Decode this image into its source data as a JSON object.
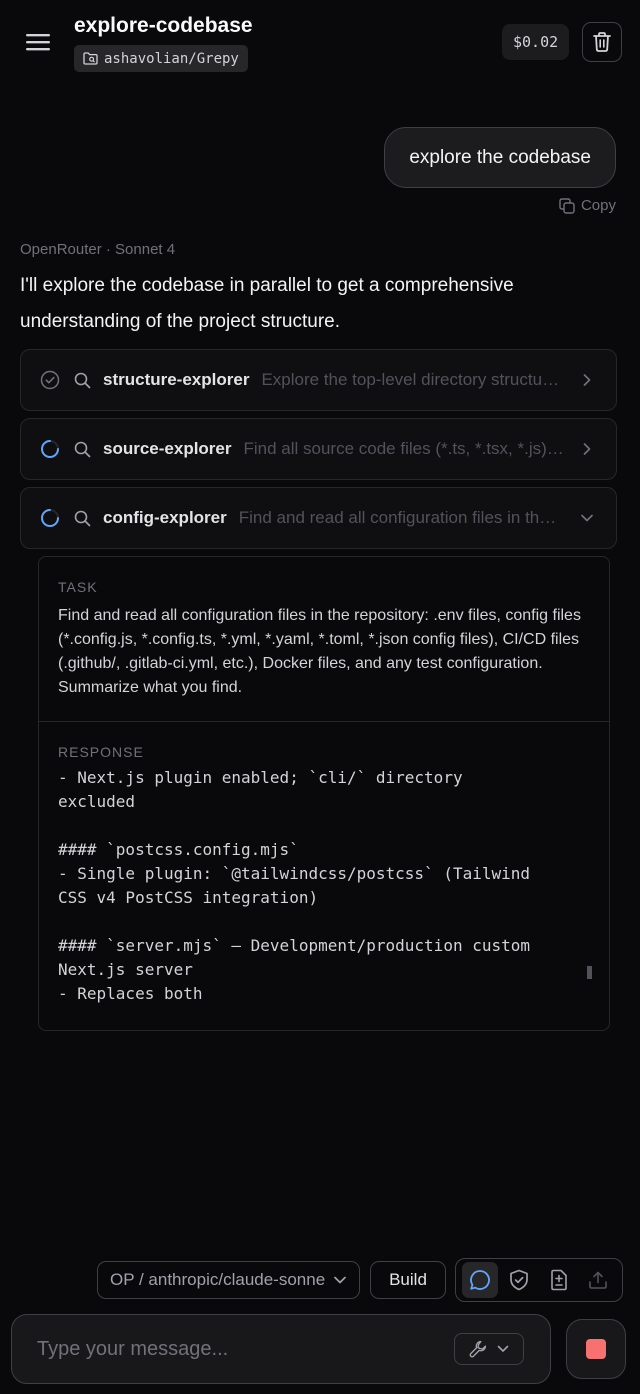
{
  "header": {
    "title": "explore-codebase",
    "repo": "ashavolian/Grepy",
    "cost": "$0.02"
  },
  "conversation": {
    "user_message": "explore the codebase",
    "copy_label": "Copy",
    "model_label": "OpenRouter · Sonnet 4",
    "assistant_text": "I'll explore the codebase in parallel to get a comprehensive understanding of the project structure."
  },
  "tools": [
    {
      "name": "structure-explorer",
      "desc": "Explore the top-level directory structure of the repository",
      "status": "done",
      "expanded": false
    },
    {
      "name": "source-explorer",
      "desc": "Find all source code files (*.ts, *.tsx, *.js) in the repository",
      "status": "running",
      "expanded": false
    },
    {
      "name": "config-explorer",
      "desc": "Find and read all configuration files in the repository",
      "status": "running",
      "expanded": true
    }
  ],
  "detail": {
    "task_label": "TASK",
    "task_text": "Find and read all configuration files in the repository: .env files, config files (*.config.js, *.config.ts, *.yml, *.yaml, *.toml, *.json config files), CI/CD files (.github/, .gitlab-ci.yml, etc.), Docker files, and any test configuration. Summarize what you find.",
    "response_label": "RESPONSE",
    "response_text": "- Next.js plugin enabled; `cli/` directory\nexcluded\n\n#### `postcss.config.mjs`\n- Single plugin: `@tailwindcss/postcss` (Tailwind\nCSS v4 PostCSS integration)\n\n#### `server.mjs` — Development/production custom\nNext.js server\n- Replaces both"
  },
  "toolbar": {
    "model": "OP / anthropic/claude-sonnet-4",
    "build_label": "Build"
  },
  "composer": {
    "placeholder": "Type your message..."
  },
  "colors": {
    "accent": "#60a5fa",
    "stop": "#f87171",
    "background": "#09090b"
  }
}
